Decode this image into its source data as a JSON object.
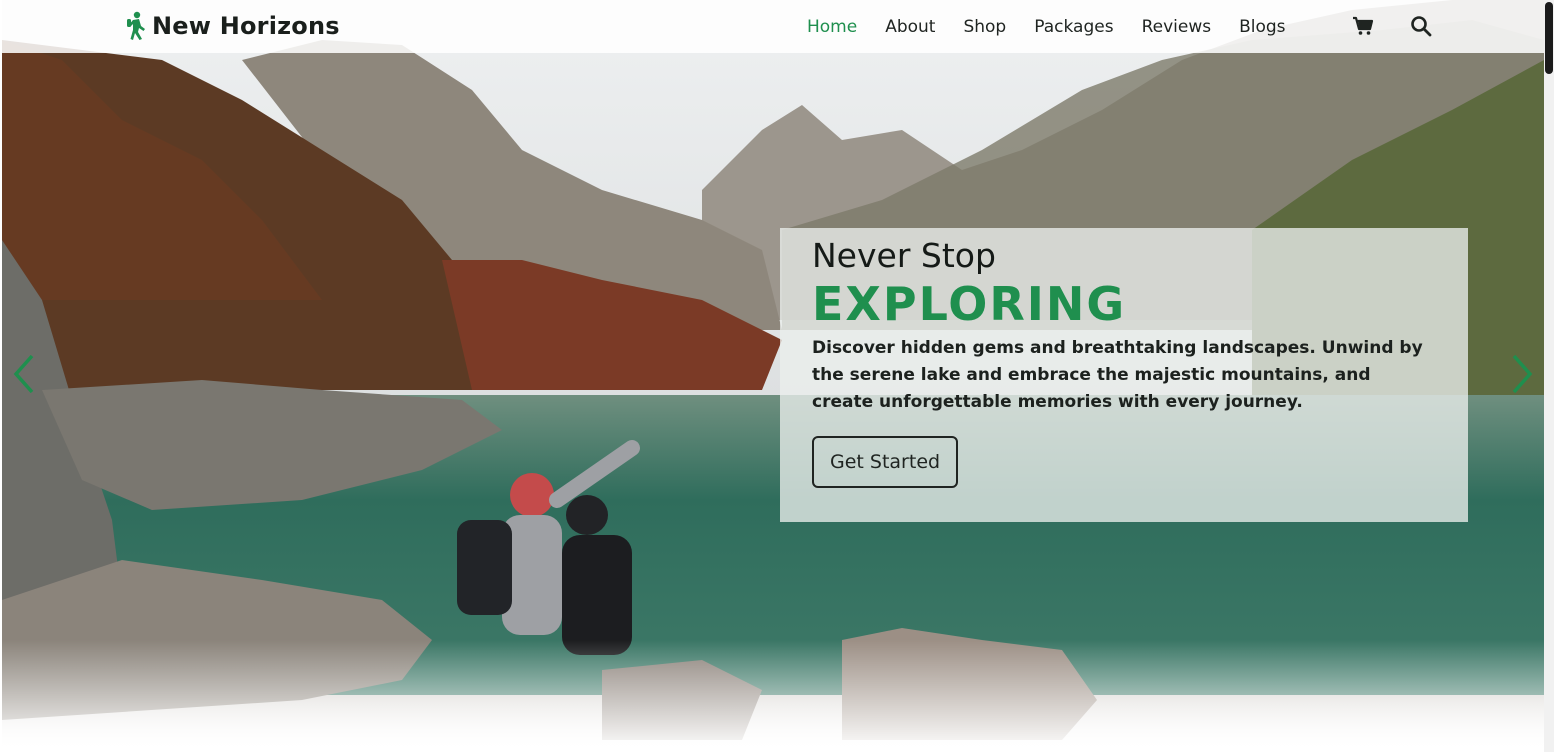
{
  "brand": {
    "name": "New Horizons",
    "icon": "hiker-icon",
    "color": "#1f8f4e"
  },
  "nav": {
    "links": [
      {
        "label": "Home",
        "active": true
      },
      {
        "label": "About",
        "active": false
      },
      {
        "label": "Shop",
        "active": false
      },
      {
        "label": "Packages",
        "active": false
      },
      {
        "label": "Reviews",
        "active": false
      },
      {
        "label": "Blogs",
        "active": false
      }
    ],
    "cart_icon": "cart-icon",
    "search_icon": "search-icon"
  },
  "hero": {
    "subtitle": "Never Stop",
    "title": "EXPLORING",
    "description": "Discover hidden gems and breathtaking landscapes. Unwind by the serene lake and embrace the majestic mountains, and create unforgettable memories with every journey.",
    "cta_label": "Get Started",
    "prev_icon": "chevron-left-icon",
    "next_icon": "chevron-right-icon"
  },
  "colors": {
    "accent": "#1f8f4e",
    "text": "#1f2421"
  }
}
